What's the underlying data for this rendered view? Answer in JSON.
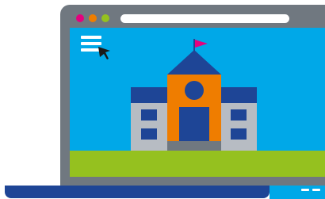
{
  "colors": {
    "laptop_frame": "#707880",
    "screen_sky": "#00a8e8",
    "grass": "#95c11f",
    "laptop_base": "#1e4596",
    "traffic_light_red": "#e5007e",
    "traffic_light_orange": "#ef7d00",
    "traffic_light_green": "#95c11f",
    "building_blue": "#1e4596",
    "building_orange": "#ef7d00",
    "building_gray": "#b7bcc3",
    "flag_pink": "#e5007e"
  },
  "icons": {
    "menu": "hamburger-menu-icon",
    "cursor": "mouse-pointer-icon",
    "building": "school-building-icon",
    "flag": "flag-icon"
  }
}
